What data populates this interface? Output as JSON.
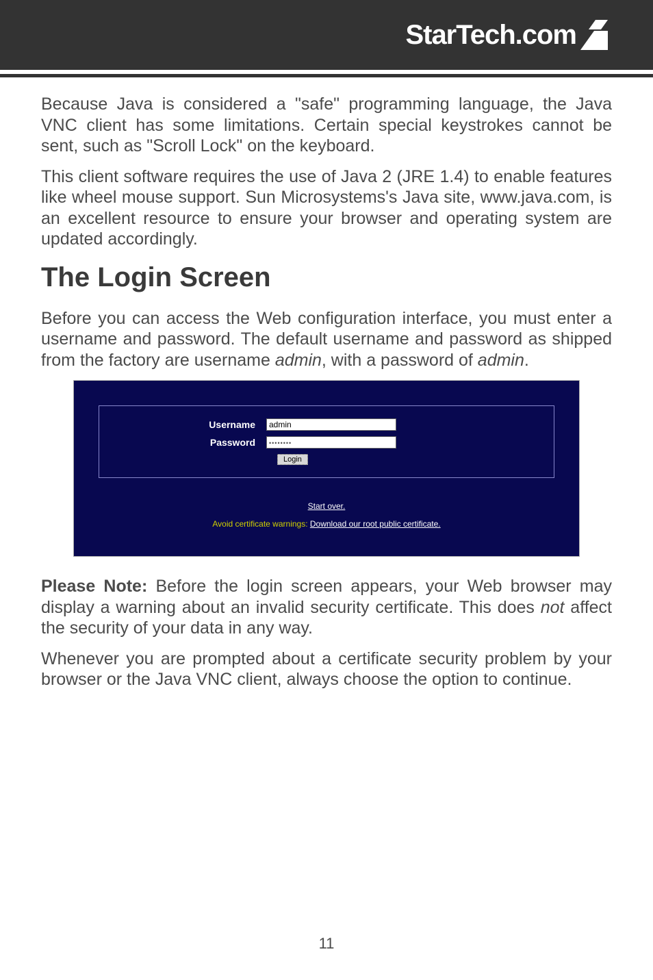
{
  "header": {
    "brand": "StarTech.com"
  },
  "paragraphs": {
    "p1": "Because Java is considered a \"safe\" programming language, the Java VNC client has some limitations. Certain special keystrokes cannot be sent, such as \"Scroll Lock\" on the keyboard.",
    "p2": "This client software requires the use of Java 2 (JRE 1.4) to enable features like wheel mouse support. Sun Microsystems's Java site, www.java.com, is an excellent resource to ensure your browser and operating system are updated accordingly.",
    "heading": "The Login Screen",
    "p3_a": "Before you can access the Web configuration interface, you must enter a username and password. The default username and password as shipped from the factory are username ",
    "p3_admin1": "admin",
    "p3_b": ", with a password of ",
    "p3_admin2": "admin",
    "p3_c": ".",
    "p4_lead": "Please Note:",
    "p4_a": " Before the login screen appears, your Web browser may display a warning about an invalid security certificate.  This does ",
    "p4_not": "not",
    "p4_b": " affect the security of your data in any way.",
    "p5": "Whenever you are prompted about a certificate security problem by your browser or the Java VNC client, always choose the option to continue."
  },
  "login": {
    "username_label": "Username",
    "username_value": "admin",
    "password_label": "Password",
    "password_value": "••••••••",
    "login_button": "Login",
    "start_over": "Start over.",
    "cert_warning": "Avoid certificate warnings: ",
    "cert_link": "Download our root public certificate."
  },
  "page_number": "11"
}
